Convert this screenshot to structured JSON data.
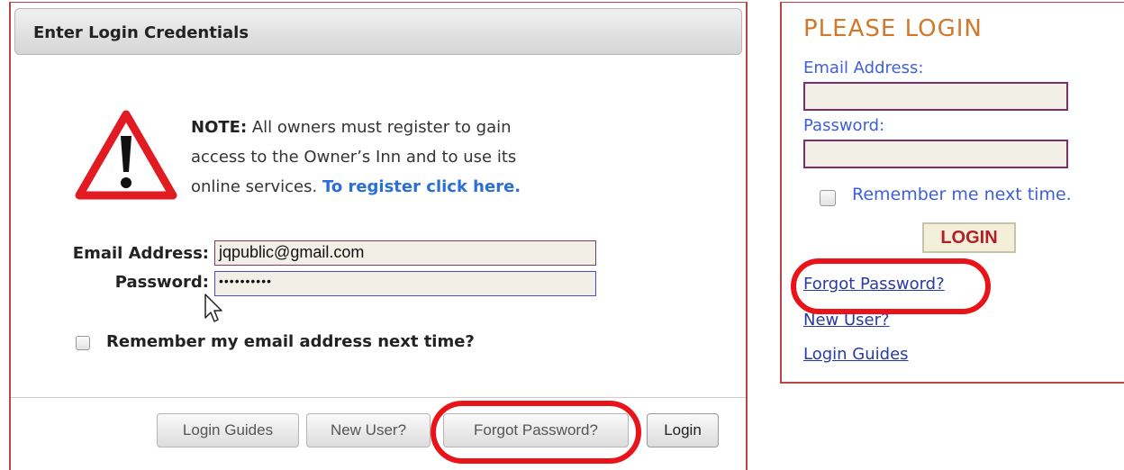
{
  "left_panel": {
    "header_title": "Enter Login Credentials",
    "note_label": "NOTE:",
    "note_text_1": " All owners must register to gain access to the Owner’s Inn and to use its online services. ",
    "register_link": "To register click here.",
    "email_label": "Email Address:",
    "email_value": "jqpublic@gmail.com",
    "password_label": "Password:",
    "password_value": "••••••••••",
    "remember_label": "Remember my email address next time?",
    "buttons": {
      "login_guides": "Login Guides",
      "new_user": "New User?",
      "forgot_password": "Forgot Password?",
      "login": "Login"
    }
  },
  "right_panel": {
    "title": "PLEASE LOGIN",
    "email_label": "Email Address:",
    "password_label": "Password:",
    "remember_label": "Remember me next time.",
    "login_button": "LOGIN",
    "forgot_link": "Forgot Password?",
    "new_user_link": "New User?",
    "guides_link": "Login Guides"
  },
  "colors": {
    "highlight_oval": "#e8141a",
    "panel_border": "#bb4444",
    "right_title": "#d2782c",
    "right_label": "#3f5fd6",
    "register_link": "#2a6fd6"
  },
  "icons": [
    "warning-triangle-icon",
    "mouse-cursor-icon"
  ]
}
